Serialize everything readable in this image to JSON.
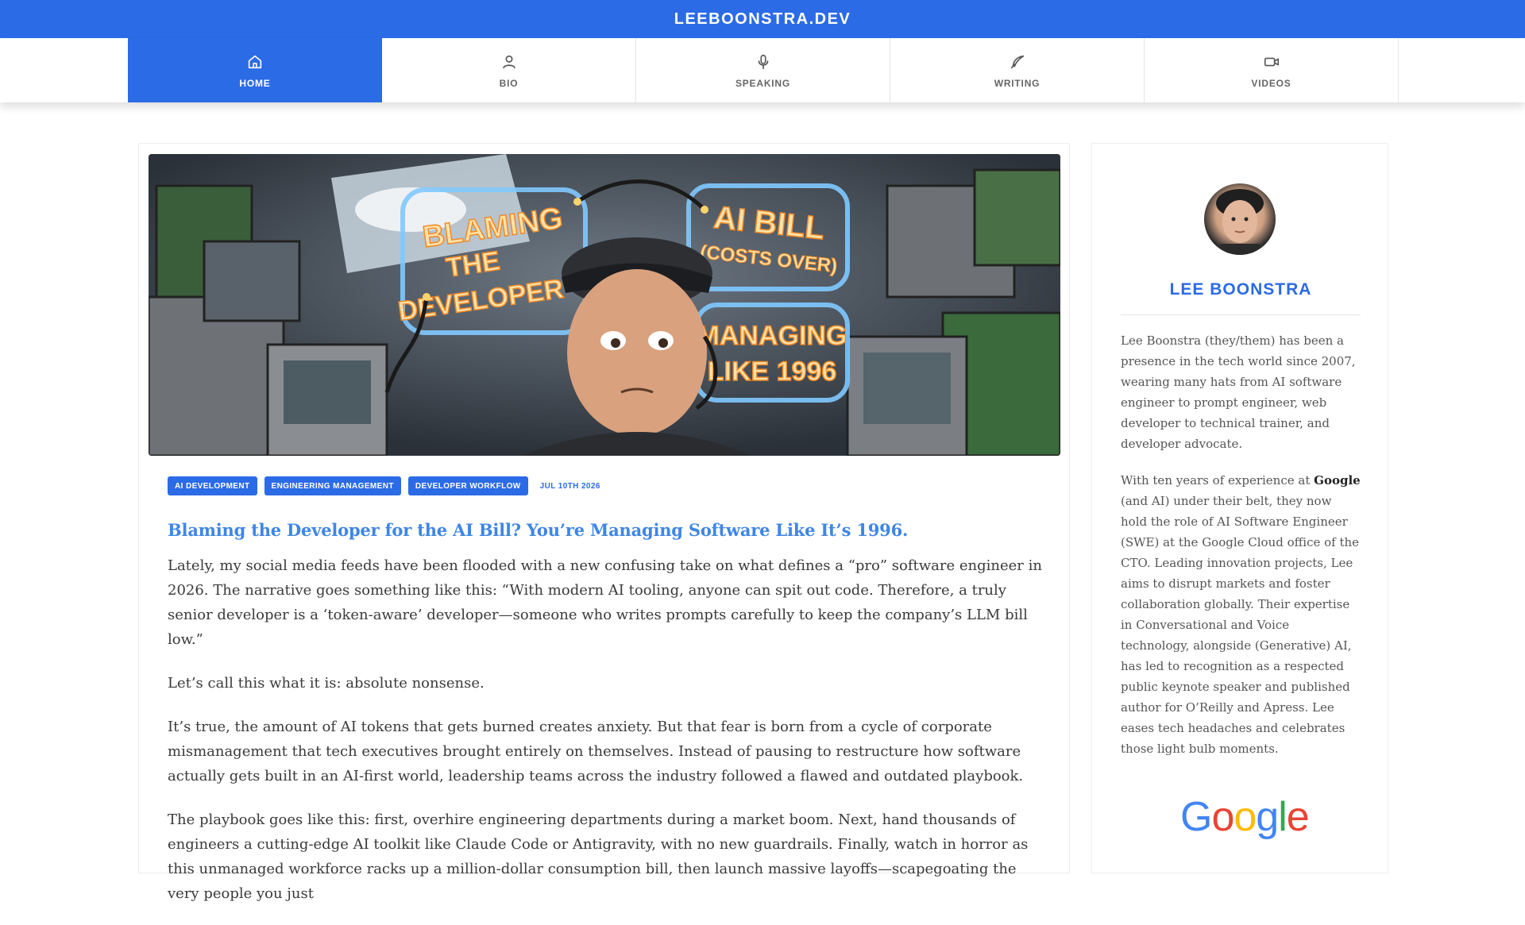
{
  "site": {
    "title": "LEEBOONSTRA.DEV"
  },
  "nav": {
    "items": [
      {
        "label": "HOME",
        "icon": "home-icon",
        "active": true
      },
      {
        "label": "BIO",
        "icon": "user-icon",
        "active": false
      },
      {
        "label": "SPEAKING",
        "icon": "microphone-icon",
        "active": false
      },
      {
        "label": "WRITING",
        "icon": "quill-icon",
        "active": false
      },
      {
        "label": "VIDEOS",
        "icon": "video-camera-icon",
        "active": false
      }
    ]
  },
  "post": {
    "hero": {
      "sign_left_1": "BLAMING",
      "sign_left_2": "THE",
      "sign_left_3": "DEVELOPER",
      "sign_right_1": "AI BILL",
      "sign_right_2": "(COSTS OVER)",
      "sign_right_3": "MANAGING",
      "sign_right_4": "LIKE 1996"
    },
    "tags": [
      "AI DEVELOPMENT",
      "ENGINEERING MANAGEMENT",
      "DEVELOPER WORKFLOW"
    ],
    "date": "JUL 10TH 2026",
    "title": "Blaming the Developer for the AI Bill? You’re Managing Software Like It’s 1996.",
    "paragraphs": [
      "Lately, my social media feeds have been flooded with a new confusing take on what defines a “pro” software engineer in 2026. The narrative goes something like this: “With modern AI tooling, anyone can spit out code. Therefore, a truly senior developer is a ‘token-aware’ developer—someone who writes prompts carefully to keep the company’s LLM bill low.”",
      "Let’s call this what it is: absolute nonsense.",
      "It’s true, the amount of AI tokens that gets burned creates anxiety. But that fear is born from a cycle of corporate mismanagement that tech executives brought entirely on themselves. Instead of pausing to restructure how software actually gets built in an AI-first world, leadership teams across the industry followed a flawed and outdated playbook.",
      "The playbook goes like this: first, overhire engineering departments during a market boom. Next, hand thousands of engineers a cutting-edge AI toolkit like Claude Code or Antigravity, with no new guardrails. Finally, watch in horror as this unmanaged workforce racks up a million-dollar consumption bill, then launch massive layoffs—scapegoating the very people you just"
    ]
  },
  "sidebar": {
    "name": "LEE BOONSTRA",
    "bio_1": "Lee Boonstra (they/them) has been a presence in the tech world since 2007, wearing many hats from AI software engineer to prompt engineer, web developer to technical trainer, and developer advocate.",
    "bio_2_prefix": "With ten years of experience at ",
    "bio_2_company": "Google",
    "bio_2_suffix": " (and AI) under their belt, they now hold the role of AI Software Engineer (SWE) at the Google Cloud office of the CTO. Leading innovation projects, Lee aims to disrupt markets and foster collaboration globally. Their expertise in Conversational and Voice technology, alongside (Generative) AI, has led to recognition as a respected public keynote speaker and published author for O’Reilly and Apress. Lee eases tech headaches and celebrates those light bulb moments.",
    "logo_letters": [
      "G",
      "o",
      "o",
      "g",
      "l",
      "e"
    ]
  },
  "colors": {
    "primary": "#2c6be6",
    "title_link": "#3f86e6",
    "google_blue": "#4285F4",
    "google_red": "#EA4335",
    "google_yellow": "#FBBC05",
    "google_green": "#34A853"
  }
}
